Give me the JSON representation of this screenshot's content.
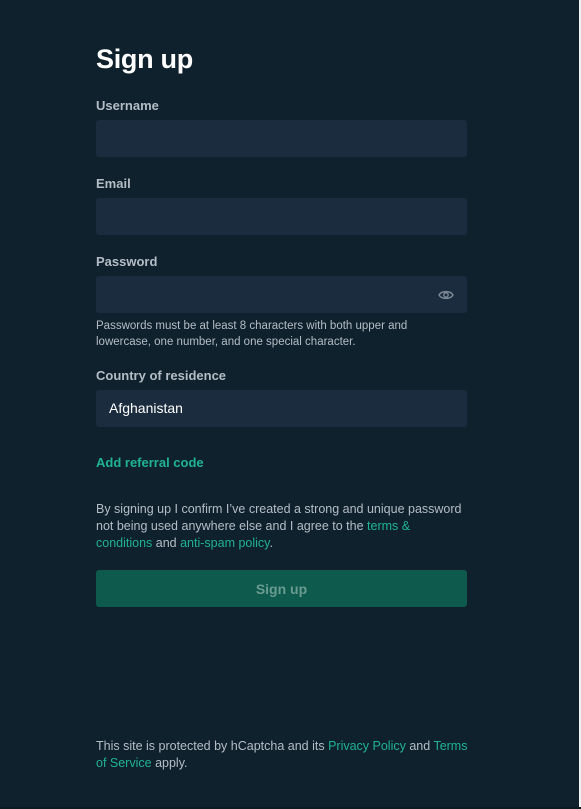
{
  "title": "Sign up",
  "fields": {
    "username": {
      "label": "Username",
      "value": ""
    },
    "email": {
      "label": "Email",
      "value": ""
    },
    "password": {
      "label": "Password",
      "value": "",
      "icon": "eye-icon",
      "hint": "Passwords must be at least 8 characters with both upper and lowercase, one number, and one special character."
    },
    "country": {
      "label": "Country of residence",
      "value": "Afghanistan"
    }
  },
  "referral_label": "Add referral code",
  "consent": {
    "text_before": "By signing up I confirm I’ve created a strong and unique password not being used anywhere else and I agree to the ",
    "terms_link": "terms & conditions",
    "text_middle": " and ",
    "antispam_link": "anti-spam policy",
    "text_after": "."
  },
  "submit_label": "Sign up",
  "footer": {
    "text_before": "This site is protected by hCaptcha and its ",
    "privacy_link": "Privacy Policy",
    "text_middle": " and ",
    "tos_link": "Terms of Service",
    "text_after": " apply."
  },
  "colors": {
    "background": "#10212e",
    "field": "#1a2c3e",
    "accent": "#1fb394",
    "button": "#0e5a4d"
  }
}
